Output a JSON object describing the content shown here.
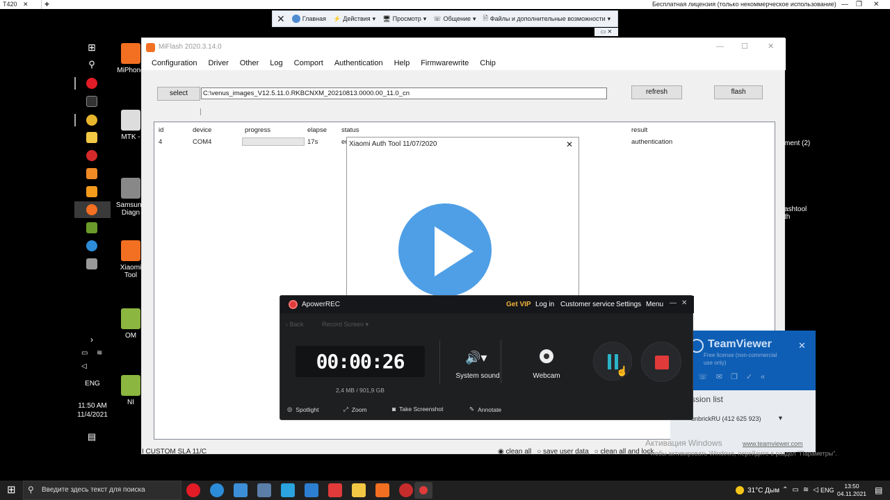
{
  "topbar": {
    "tab_label": "T420",
    "tab_close": "✕",
    "new_tab": "+",
    "license_text": "Бесплатная лицензия (только некоммерческое использование)"
  },
  "tv_toolbar": {
    "close": "✕",
    "items": [
      {
        "label": "Главная"
      },
      {
        "label": "Действия"
      },
      {
        "label": "Просмотр"
      },
      {
        "label": "Общение"
      },
      {
        "label": "Файлы и дополнительные возможности"
      }
    ]
  },
  "remote_desktop": {
    "icons": [
      {
        "label": "MiPhone"
      },
      {
        "label": "MTK -"
      },
      {
        "label": "Samsung Diagn"
      },
      {
        "label": "Xiaomi Tool"
      },
      {
        "label": "OM"
      },
      {
        "label": "NI"
      }
    ],
    "right_labels": [
      "ment (2)",
      "ashtool th"
    ],
    "lang": "ENG",
    "time": "11:50 AM",
    "date": "11/4/2021"
  },
  "miflash": {
    "title": "MiFlash 2020.3.14.0",
    "menu": [
      "Configuration",
      "Driver",
      "Other",
      "Log",
      "Comport",
      "Authentication",
      "Help",
      "Firmwarewrite",
      "Chip"
    ],
    "select_label": "select",
    "path_value": "C:\\venus_images_V12.5.11.0.RKBCNXM_20210813.0000.00_11.0_cn",
    "refresh_label": "refresh",
    "flash_label": "flash",
    "columns": {
      "id": "id",
      "device": "device",
      "progress": "progress",
      "elapse": "elapse",
      "status": "status",
      "result": "result"
    },
    "row": {
      "id": "4",
      "device": "COM4",
      "progress": 0,
      "elapse": "17s",
      "status": "ed",
      "result": "authentication"
    },
    "bottom_left": "I CUSTOM SLA 11/C",
    "options": [
      "clean all",
      "save user data",
      "clean all and lock"
    ],
    "selected_option": "clean all"
  },
  "auth_dialog": {
    "title": "Xiaomi Auth Tool 11/07/2020",
    "close": "✕"
  },
  "apowerrec": {
    "app_name": "ApowerREC",
    "get_vip": "Get VIP",
    "log_in": "Log in",
    "customer_service": "Customer service",
    "settings": "Settings",
    "menu": "Menu",
    "back": "Back",
    "record_screen": "Record Screen",
    "timer": "00:00:26",
    "storage": "2,4 MB / 901,9 GB",
    "system_sound": "System sound",
    "webcam": "Webcam",
    "tools": [
      "Spotlight",
      "Zoom",
      "Take Screenshot",
      "Annotate"
    ]
  },
  "teamviewer_panel": {
    "brand": "TeamViewer",
    "free_license": "Free license (non-commercial use only)",
    "session_list": "ssion list",
    "session_item": "unbrickRU (412 625 923)",
    "site": "www.teamviewer.com"
  },
  "activation": {
    "title": "Активация Windows",
    "subtitle": "Чтобы активировать Windows, перейдите в раздел \"Параметры\"."
  },
  "taskbar": {
    "search_placeholder": "Введите здесь текст для поиска",
    "weather": "31°C Дым",
    "lang": "ENG",
    "time": "13:50",
    "date": "04.11.2021"
  },
  "colors": {
    "play": "#4e9fe6",
    "record_red": "#e03a3a",
    "pause_teal": "#2bb3c8",
    "vip_gold": "#f0b43c",
    "teamviewer_blue": "#0e5eb5"
  }
}
